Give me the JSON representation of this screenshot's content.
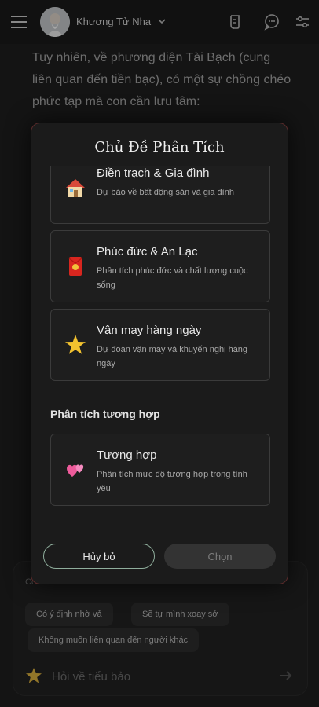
{
  "header": {
    "username": "Khương Tử Nha",
    "icons": [
      "menu-icon",
      "chevron-down-icon",
      "scroll-icon",
      "chat-bubble-icon",
      "sliders-icon"
    ]
  },
  "background": {
    "message_text": "Tuy nhiên, về phương diện Tài Bạch (cung liên quan đến tiền bạc), có một sự chồng chéo phức tạp mà con cần lưu tâm:"
  },
  "chat": {
    "hint_text": "Con...",
    "chips": [
      "Có ý định nhờ vả",
      "Sẽ tự mình xoay sở",
      "Không muốn liên quan đến người khác"
    ],
    "input_placeholder": "Hỏi về tiểu bảo"
  },
  "modal": {
    "title": "Chủ Đề Phân Tích",
    "topics": [
      {
        "name": "Điền trạch & Gia đình",
        "desc": "Dự báo về bất động sản và gia đình",
        "icon": "house-icon"
      },
      {
        "name": "Phúc đức & An Lạc",
        "desc": "Phân tích phúc đức và chất lượng cuộc sống",
        "icon": "red-envelope-icon"
      },
      {
        "name": "Vận may hàng ngày",
        "desc": "Dự đoán vận may và khuyến nghị hàng ngày",
        "icon": "star-icon"
      }
    ],
    "section_compat": "Phân tích tương hợp",
    "compat_topic": {
      "name": "Tương hợp",
      "desc": "Phân tích mức độ tương hợp trong tình yêu",
      "icon": "hearts-icon"
    },
    "cancel_label": "Hủy bỏ",
    "choose_label": "Chọn"
  },
  "colors": {
    "modal_border": "#5a2a2a",
    "cancel_border": "#8fae9c",
    "disabled_button": "#333333"
  }
}
